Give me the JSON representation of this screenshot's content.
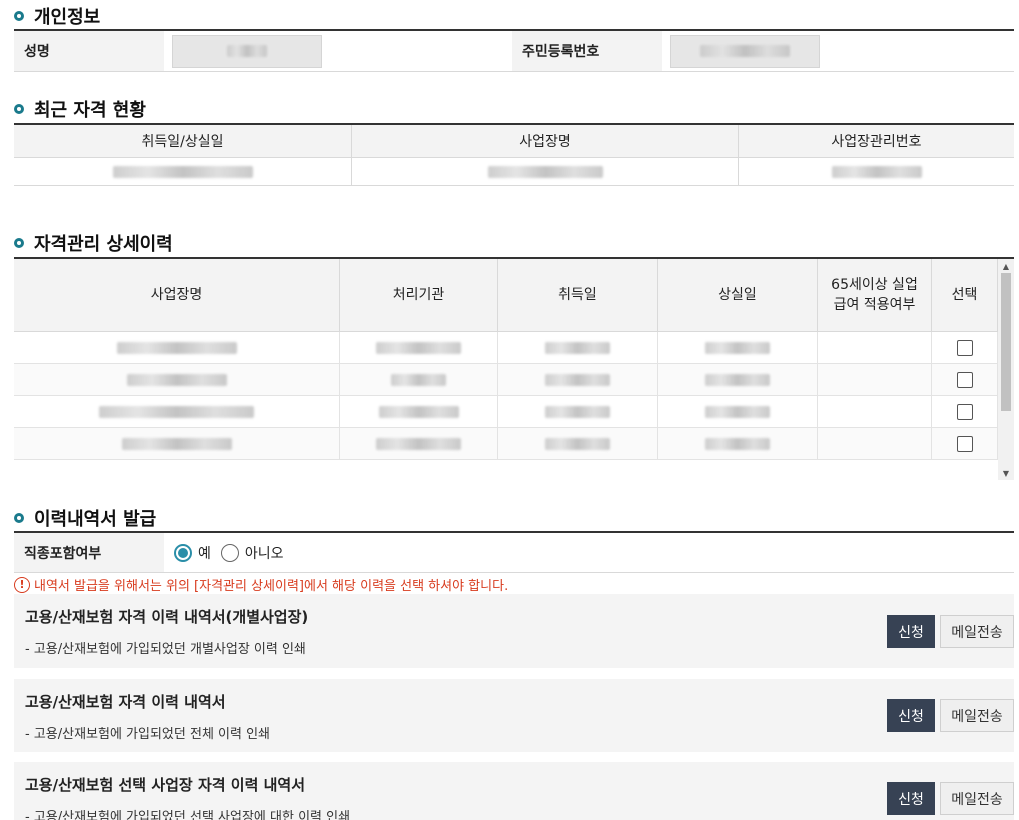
{
  "personal": {
    "title": "개인정보",
    "name_label": "성명",
    "rrn_label": "주민등록번호"
  },
  "recent": {
    "title": "최근 자격 현황",
    "columns": [
      "취득일/상실일",
      "사업장명",
      "사업장관리번호"
    ]
  },
  "history": {
    "title": "자격관리 상세이력",
    "columns": [
      "사업장명",
      "처리기관",
      "취득일",
      "상실일",
      "65세이상 실업급여 적용여부",
      "선택"
    ],
    "row_count": 4
  },
  "issuance": {
    "title": "이력내역서 발급",
    "option_label": "직종포함여부",
    "option_yes": "예",
    "option_no": "아니오",
    "selected": "예",
    "notice": "내역서 발급을 위해서는 위의 [자격관리 상세이력]에서 해당 이력을 선택 하셔야 합니다.",
    "documents": [
      {
        "title": "고용/산재보험 자격 이력 내역서(개별사업장)",
        "desc": "- 고용/산재보험에 가입되었던 개별사업장 이력 인쇄",
        "apply": "신청",
        "mail": "메일전송"
      },
      {
        "title": "고용/산재보험 자격 이력 내역서",
        "desc": "- 고용/산재보험에 가입되었던 전체 이력 인쇄",
        "apply": "신청",
        "mail": "메일전송"
      },
      {
        "title": "고용/산재보험 선택 사업장 자격 이력 내역서",
        "desc": "- 고용/산재보험에 가입되었던 선택 사업장에 대한 이력 인쇄",
        "apply": "신청",
        "mail": "메일전송"
      }
    ]
  },
  "colors": {
    "accent": "#1a7a8c",
    "button_dark": "#374254",
    "notice_red": "#d83b1e"
  }
}
